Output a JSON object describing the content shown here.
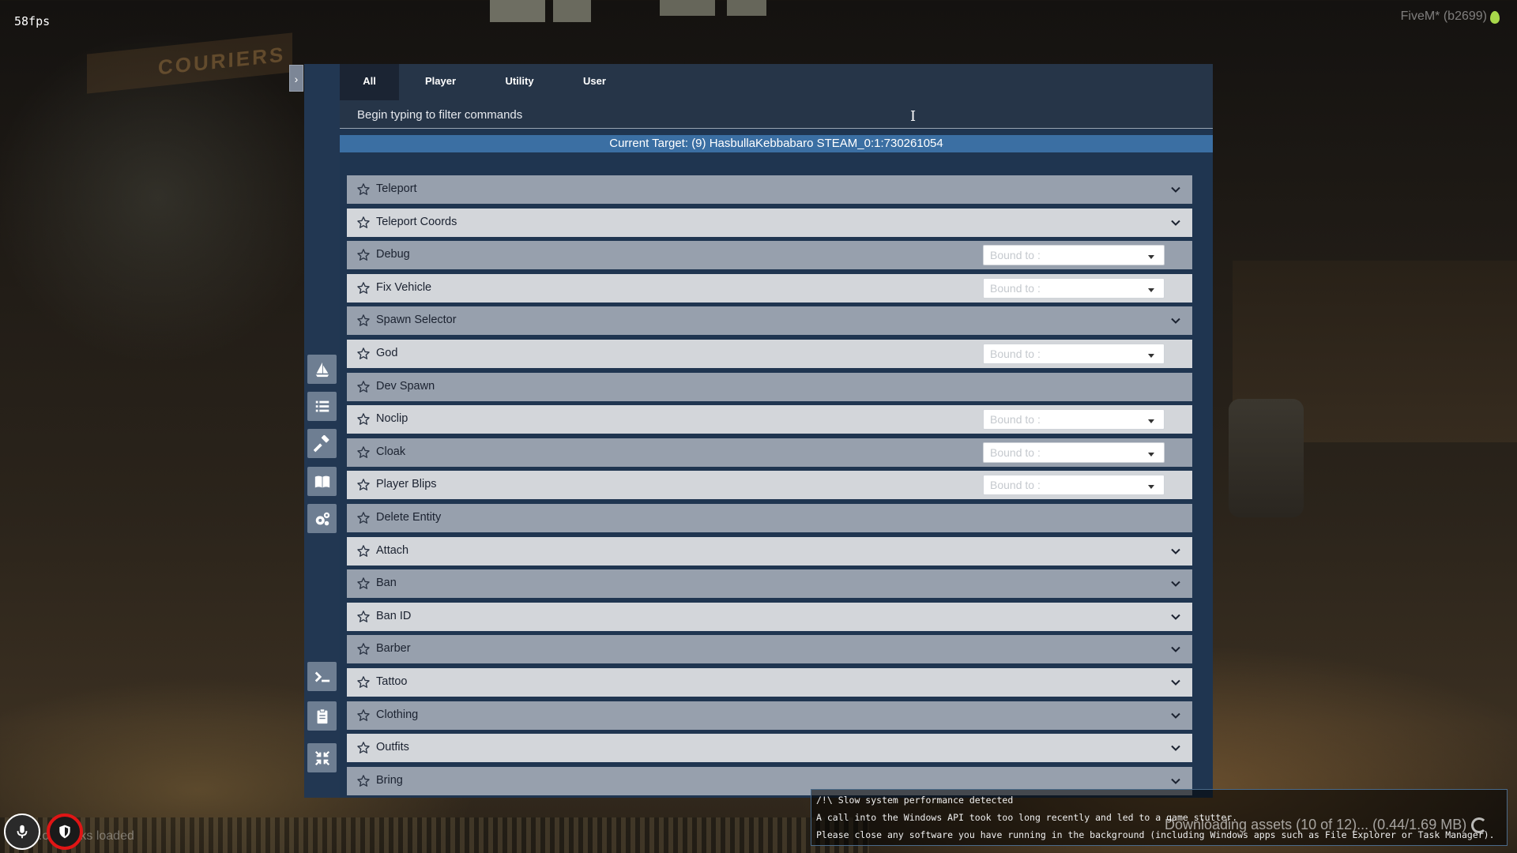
{
  "hud": {
    "fps": "58fps",
    "build": "FiveM* (b2699)",
    "scene_sign": "COURIERS",
    "packs_loaded": "...od packs loaded",
    "download_status": "Downloading assets (10 of 12)... (0.44/1.69 MB)"
  },
  "warning": {
    "line1": "/!\\ Slow system performance detected",
    "line2": "A call into the Windows API took too long recently and led to a game stutter.",
    "line3": "Please close any software you have running in the background (including Windows apps such as File Explorer or Task Manager)."
  },
  "menu": {
    "toggle_glyph": "›",
    "tabs": [
      "All",
      "Player",
      "Utility",
      "User"
    ],
    "active_tab": "All",
    "filter_placeholder": "Begin typing to filter commands",
    "current_target": "Current Target: (9) HasbullaKebbabaro STEAM_0:1:730261054",
    "bound_placeholder": "Bound to :",
    "rail_icons": [
      "ship-icon",
      "list-icon",
      "hammer-icon",
      "book-icon",
      "gears-icon",
      "terminal-icon",
      "clipboard-icon",
      "compress-icon"
    ],
    "commands": [
      {
        "label": "Teleport",
        "type": "expand"
      },
      {
        "label": "Teleport Coords",
        "type": "expand"
      },
      {
        "label": "Debug",
        "type": "bind"
      },
      {
        "label": "Fix Vehicle",
        "type": "bind"
      },
      {
        "label": "Spawn Selector",
        "type": "expand"
      },
      {
        "label": "God",
        "type": "bind"
      },
      {
        "label": "Dev Spawn",
        "type": "plain"
      },
      {
        "label": "Noclip",
        "type": "bind"
      },
      {
        "label": "Cloak",
        "type": "bind"
      },
      {
        "label": "Player Blips",
        "type": "bind"
      },
      {
        "label": "Delete Entity",
        "type": "plain"
      },
      {
        "label": "Attach",
        "type": "expand"
      },
      {
        "label": "Ban",
        "type": "expand"
      },
      {
        "label": "Ban ID",
        "type": "expand"
      },
      {
        "label": "Barber",
        "type": "expand"
      },
      {
        "label": "Tattoo",
        "type": "expand"
      },
      {
        "label": "Clothing",
        "type": "expand"
      },
      {
        "label": "Outfits",
        "type": "expand"
      },
      {
        "label": "Bring",
        "type": "expand"
      }
    ]
  },
  "colors": {
    "panel": "#1f3550",
    "target_bar": "#3b6fa3",
    "row_dark": "#97a0ad",
    "row_light": "#d3d6da",
    "rail_button": "#6e7e92"
  }
}
